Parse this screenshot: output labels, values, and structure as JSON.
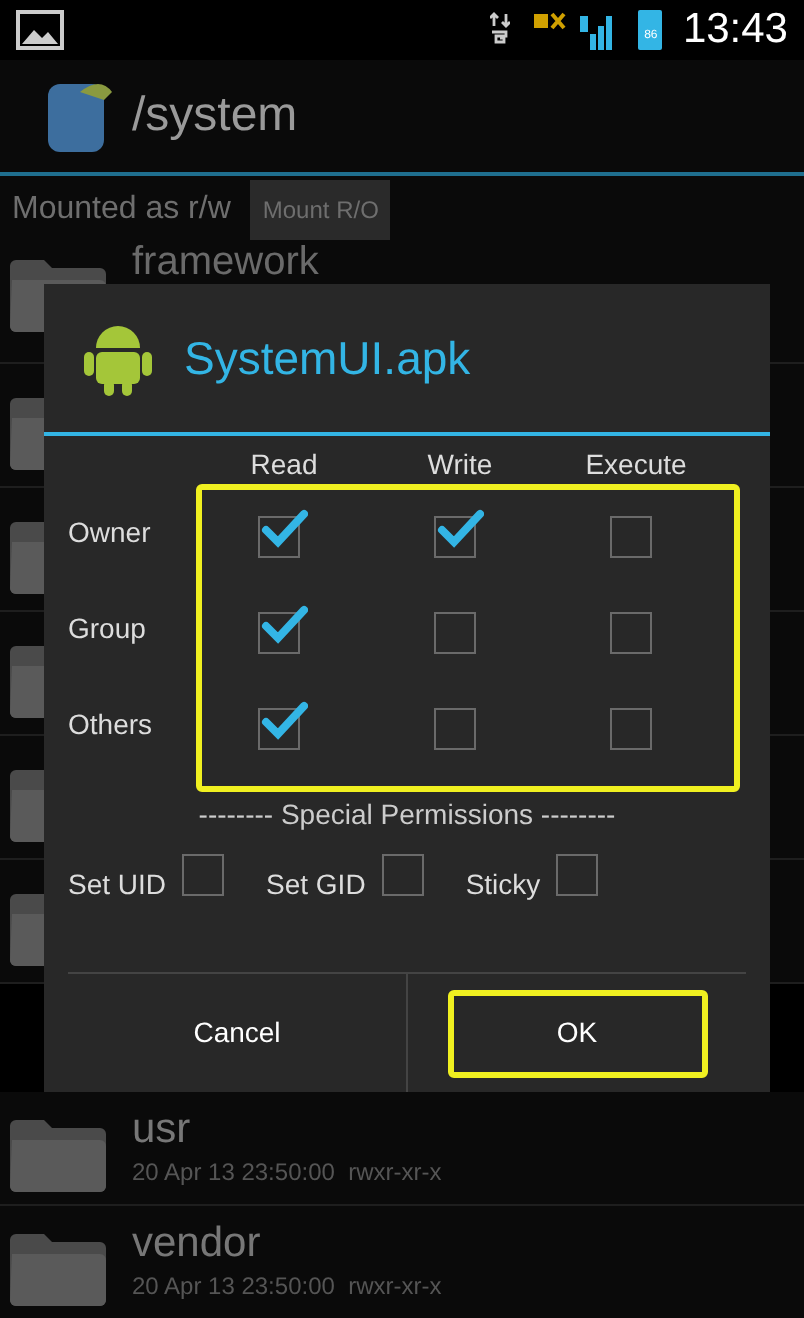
{
  "status_bar": {
    "battery_text": "86",
    "time": "13:43"
  },
  "header": {
    "title": "/system"
  },
  "mount_bar": {
    "label": "Mounted as r/w",
    "button": "Mount R/O"
  },
  "files_behind": [
    {
      "name": "framework"
    }
  ],
  "dialog": {
    "title": "SystemUI.apk",
    "columns": [
      "Read",
      "Write",
      "Execute"
    ],
    "grid_highlighted": true,
    "rows": [
      {
        "label": "Owner",
        "checks": [
          {
            "checked": true
          },
          {
            "checked": true
          },
          {
            "checked": false
          }
        ]
      },
      {
        "label": "Group",
        "checks": [
          {
            "checked": true
          },
          {
            "checked": false
          },
          {
            "checked": false
          }
        ]
      },
      {
        "label": "Others",
        "checks": [
          {
            "checked": true
          },
          {
            "checked": false
          },
          {
            "checked": false
          }
        ]
      }
    ],
    "special_heading": "-------- Special Permissions --------",
    "special": [
      {
        "label": "Set UID",
        "checked": false
      },
      {
        "label": "Set GID",
        "checked": false
      },
      {
        "label": "Sticky",
        "checked": false
      }
    ],
    "buttons": [
      {
        "label": "Cancel",
        "highlighted": false
      },
      {
        "label": "OK",
        "highlighted": true
      }
    ]
  },
  "files_below": [
    {
      "name": "usr",
      "details": "20 Apr 13 23:50:00  rwxr-xr-x"
    },
    {
      "name": "vendor",
      "details": "20 Apr 13 23:50:00  rwxr-xr-x"
    }
  ]
}
